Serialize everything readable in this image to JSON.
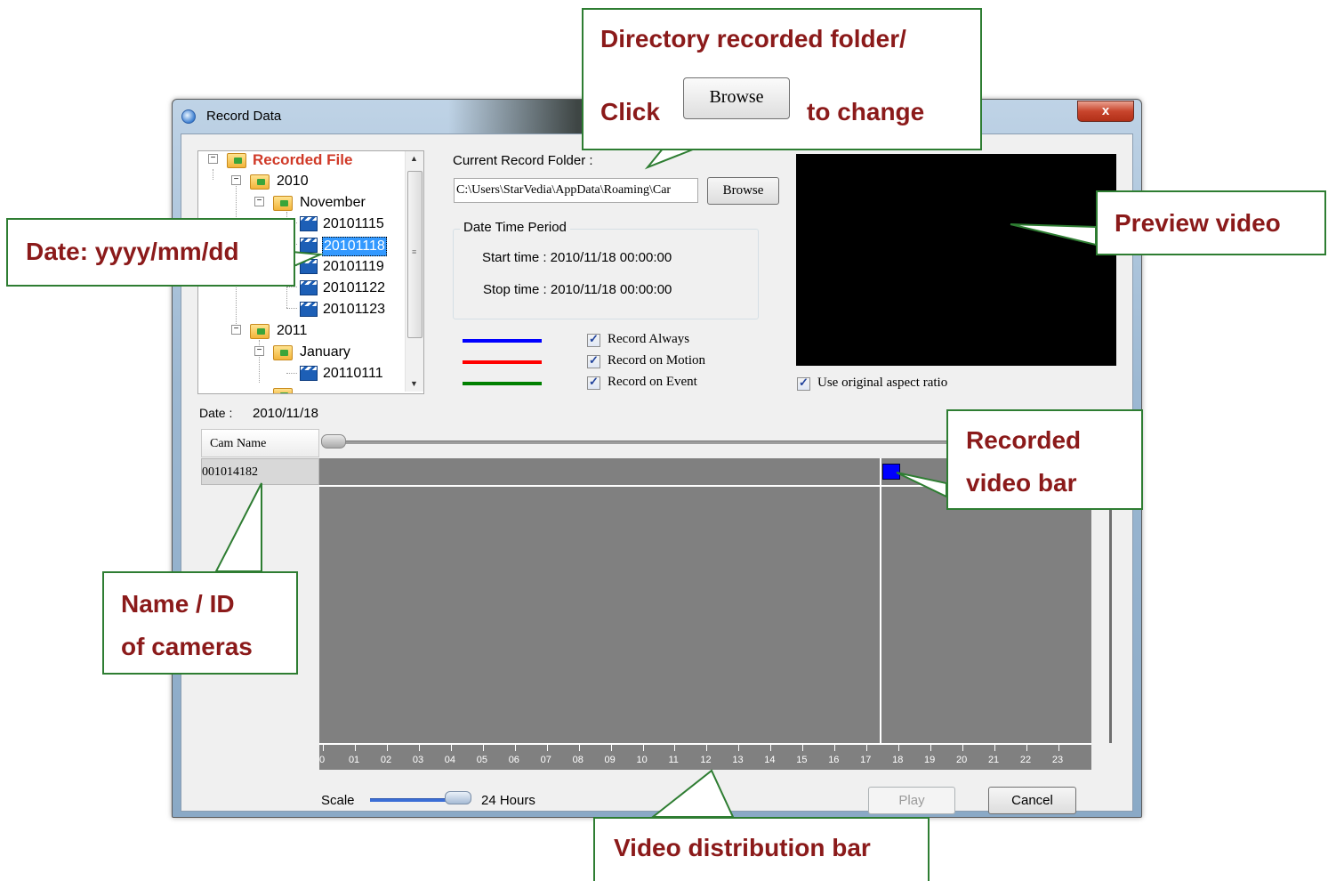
{
  "window": {
    "title": "Record Data",
    "close_label": "x"
  },
  "tree": {
    "root": "Recorded File",
    "years": [
      {
        "label": "2010",
        "months": [
          {
            "label": "November",
            "days": [
              "20101115",
              "20101118",
              "20101119",
              "20101122",
              "20101123"
            ]
          }
        ]
      },
      {
        "label": "2011",
        "months": [
          {
            "label": "January",
            "days": [
              "20110111"
            ]
          }
        ]
      }
    ],
    "selected_day": "20101118"
  },
  "folder": {
    "label": "Current Record Folder :",
    "path": "C:\\Users\\StarVedia\\AppData\\Roaming\\Car",
    "browse_label": "Browse"
  },
  "period": {
    "group_label": "Date Time Period",
    "start": "Start time : 2010/11/18 00:00:00",
    "stop": "Stop time : 2010/11/18 00:00:00"
  },
  "legend": [
    {
      "label": "Record Always",
      "color": "#0000ff",
      "checked": true
    },
    {
      "label": "Record on Motion",
      "color": "#ff0000",
      "checked": true
    },
    {
      "label": "Record on Event",
      "color": "#008000",
      "checked": true
    }
  ],
  "aspect": {
    "label": "Use original aspect ratio",
    "checked": true
  },
  "date": {
    "label": "Date :",
    "value": "2010/11/18"
  },
  "cams": {
    "header": "Cam Name",
    "rows": [
      "001014182"
    ]
  },
  "timeline": {
    "hours": [
      "0",
      "01",
      "02",
      "03",
      "04",
      "05",
      "06",
      "07",
      "08",
      "09",
      "10",
      "11",
      "12",
      "13",
      "14",
      "15",
      "16",
      "17",
      "18",
      "19",
      "20",
      "21",
      "22",
      "23"
    ],
    "cursor_hour": 17.4,
    "recording_start_hour": 17.5,
    "recording_end_hour": 18.0
  },
  "scale": {
    "label": "Scale",
    "value": "24 Hours"
  },
  "buttons": {
    "play": "Play",
    "cancel": "Cancel"
  },
  "annotations": {
    "directory_line1": "Directory recorded folder/",
    "click": "Click",
    "browse_inline": "Browse",
    "to_change": "to change",
    "date_format": "Date: yyyy/mm/dd",
    "preview": "Preview video",
    "recorded_line1": "Recorded",
    "recorded_line2": "video bar",
    "name_line1": "Name / ID",
    "name_line2": "of cameras",
    "distribution": "Video distribution bar"
  },
  "colors": {
    "annotation_text": "#8b1a1a",
    "annotation_border": "#2e7d32",
    "timeline_bg": "#808080",
    "preview_bg": "#000000",
    "recording_bar": "#0000ff"
  }
}
